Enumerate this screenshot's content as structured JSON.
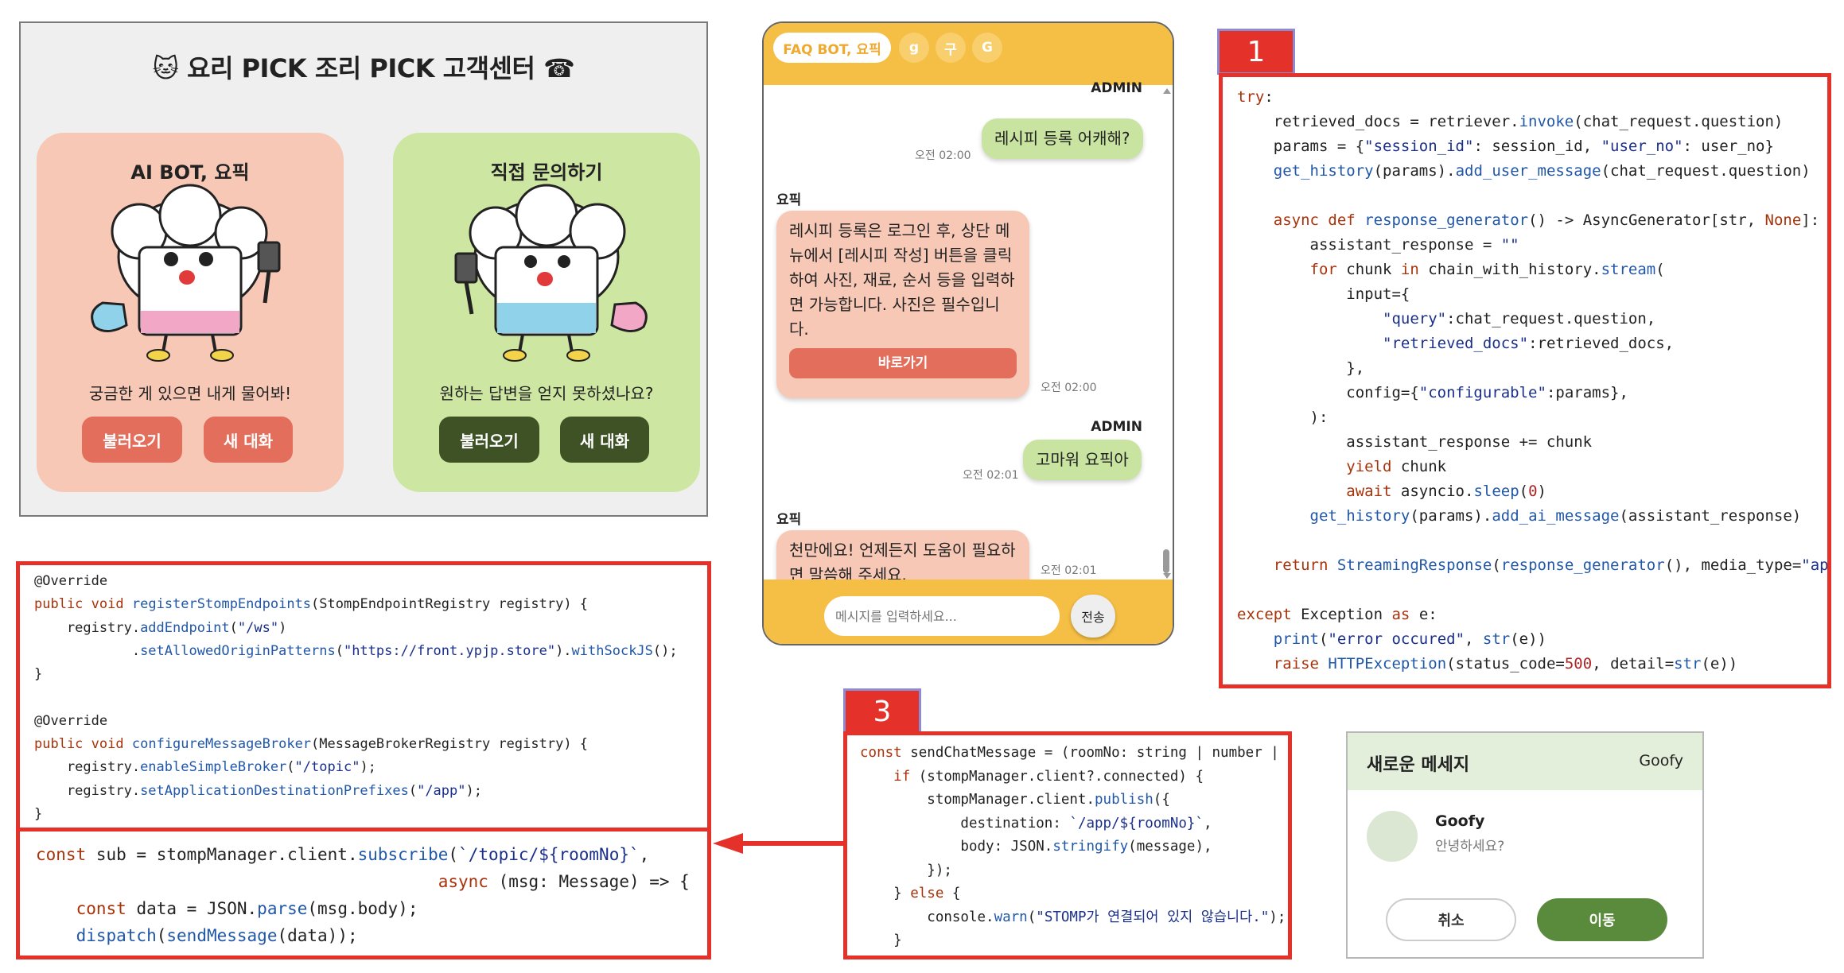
{
  "customer_center": {
    "title": "요리 PICK 조리 PICK 고객센터",
    "mascot_emoji": "🐱",
    "phone_icon": "☎",
    "ai_card": {
      "title": "AI BOT, 요픽",
      "subtitle": "궁금한 게 있으면 내게 물어봐!",
      "load_button": "불러오기",
      "new_chat_button": "새 대화",
      "color": "#f7c8b6"
    },
    "direct_card": {
      "title": "직접 문의하기",
      "subtitle": "원하는 답변을 얻지 못하셨나요?",
      "load_button": "불러오기",
      "new_chat_button": "새 대화",
      "color": "#cde7a3"
    }
  },
  "chat": {
    "tabs": [
      "FAQ BOT, 요픽",
      "g",
      "구",
      "G"
    ],
    "header_color": "#f5be45",
    "messages": [
      {
        "sender": "ADMIN",
        "text": "레시피 등록 어캐해?",
        "time": "오전 02:00"
      },
      {
        "sender": "요픽",
        "text": "레시피 등록은 로그인 후, 상단 메뉴에서 [레시피 작성] 버튼을 클릭하여 사진, 재료, 순서 등을 입력하면 가능합니다. 사진은 필수입니다.",
        "lines": [
          "레시피 등록은 로그인 후, 상단 메",
          "뉴에서 [레시피 작성] 버튼을 클릭",
          "하여 사진, 재료, 순서 등을 입력하",
          "면 가능합니다. 사진은 필수입니",
          "다."
        ],
        "button": "바로가기",
        "time": "오전 02:00"
      },
      {
        "sender": "ADMIN",
        "text": "고마워 요픽아",
        "time": "오전 02:01"
      },
      {
        "sender": "요픽",
        "text": "천만에요! 언제든지 도움이 필요하면 말씀해 주세요.",
        "lines": [
          "천만에요! 언제든지 도움이 필요하",
          "면 말씀해 주세요."
        ],
        "time": "오전 02:01"
      }
    ],
    "input_placeholder": "메시지를 입력하세요...",
    "send_button": "전송"
  },
  "badges": {
    "one": "1",
    "three": "3"
  },
  "code_python": [
    "try:",
    "    retrieved_docs = retriever.invoke(chat_request.question)",
    "    params = {\"session_id\": session_id, \"user_no\": user_no}",
    "    get_history(params).add_user_message(chat_request.question)",
    "",
    "    async def response_generator() -> AsyncGenerator[str, None]:",
    "        assistant_response = \"\"",
    "        for chunk in chain_with_history.stream(",
    "            input={",
    "                \"query\":chat_request.question,",
    "                \"retrieved_docs\":retrieved_docs,",
    "            },",
    "            config={\"configurable\":params},",
    "        ):",
    "            assistant_response += chunk",
    "            yield chunk",
    "            await asyncio.sleep(0)",
    "        get_history(params).add_ai_message(assistant_response)",
    "",
    "    return StreamingResponse(response_generator(), media_type=\"app",
    "",
    "except Exception as e:",
    "    print(\"error occured\", str(e))",
    "    raise HTTPException(status_code=500, detail=str(e))"
  ],
  "code_java": [
    "@Override",
    "public void registerStompEndpoints(StompEndpointRegistry registry) {",
    "    registry.addEndpoint(\"/ws\")",
    "            .setAllowedOriginPatterns(\"https://front.ypjp.store\").withSockJS();",
    "}",
    "",
    "@Override",
    "public void configureMessageBroker(MessageBrokerRegistry registry) {",
    "    registry.enableSimpleBroker(\"/topic\");",
    "    registry.setApplicationDestinationPrefixes(\"/app\");",
    "}"
  ],
  "code_subscribe": [
    "const sub = stompManager.client.subscribe(`/topic/${roomNo}`,",
    "                                        async (msg: Message) => {",
    "    const data = JSON.parse(msg.body);",
    "    dispatch(sendMessage(data));"
  ],
  "code_send": [
    "const sendChatMessage = (roomNo: string | number |",
    "    if (stompManager.client?.connected) {",
    "        stompManager.client.publish({",
    "            destination: `/app/${roomNo}`,",
    "            body: JSON.stringify(message),",
    "        });",
    "    } else {",
    "        console.warn(\"STOMP가 연결되어 있지 않습니다.\");",
    "    }"
  ],
  "notification": {
    "title": "새로운 메세지",
    "sender_label": "Goofy",
    "sender_name": "Goofy",
    "message": "안녕하세요?",
    "cancel_button": "취소",
    "move_button": "이동",
    "accent_color": "#5a8a3c"
  }
}
